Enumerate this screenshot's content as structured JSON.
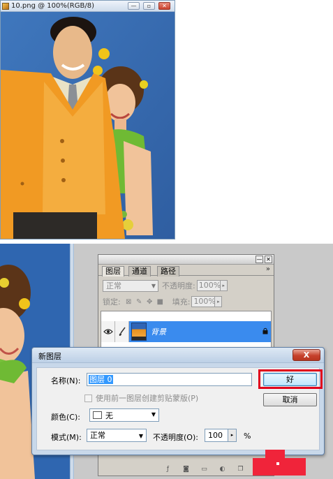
{
  "document": {
    "title": "10.png @ 100%(RGB/8)",
    "minimize_glyph": "—",
    "restore_glyph": "▫",
    "close_glyph": "✕"
  },
  "layers_panel": {
    "tabs": [
      "图层",
      "通道",
      "路径"
    ],
    "menu_glyph": "»",
    "minimize_glyph": "—",
    "close_glyph": "✕",
    "blend_mode": "正常",
    "opacity_label": "不透明度:",
    "opacity_value": "100%",
    "lock_label": "锁定:",
    "fill_label": "填充:",
    "fill_value": "100%",
    "layer_name": "背景"
  },
  "dialog": {
    "title": "新图层",
    "close_glyph": "X",
    "name_label": "名称(N):",
    "name_value": "图层 0",
    "clip_label": "使用前一图层创建剪贴蒙版(P)",
    "color_label": "颜色(C):",
    "color_value": "无",
    "mode_label": "模式(M):",
    "mode_value": "正常",
    "opacity_label": "不透明度(O):",
    "opacity_value": "100",
    "opacity_unit": "%",
    "ok_label": "好",
    "cancel_label": "取消"
  },
  "colors": {
    "photo_background": "#3b6fb0",
    "selected_layer": "#3a8bee",
    "highlight_frame": "#e0001b",
    "watermark": "#f0243a"
  },
  "icons": {
    "eye": "eye-icon",
    "brush": "brush-icon",
    "lock": "lock-icon",
    "panel_footer": [
      "link-icon",
      "layer-style-icon",
      "mask-icon",
      "folder-icon",
      "adjustment-icon",
      "new-layer-icon",
      "trash-icon"
    ]
  }
}
